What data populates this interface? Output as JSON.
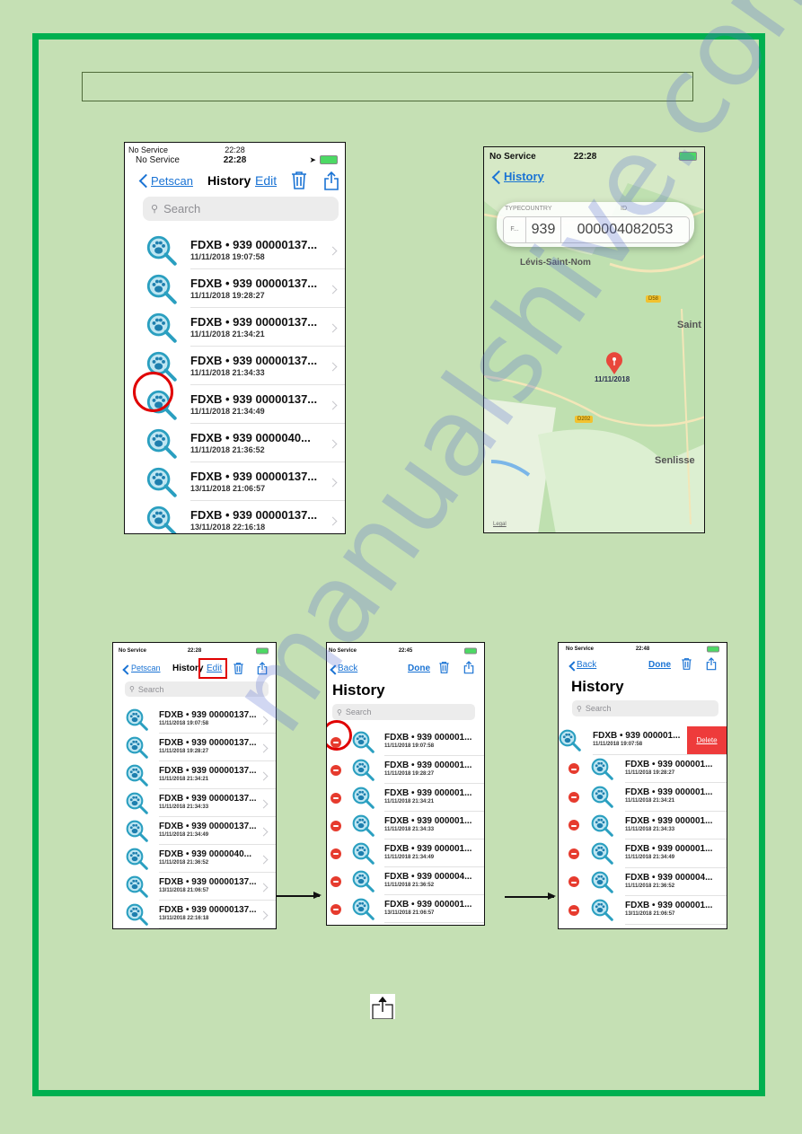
{
  "watermark": "manualshive.com",
  "colors": {
    "frame": "#00b050",
    "background": "#c5e0b4",
    "ios_blue": "#1a73d4",
    "delete_red": "#e63b2e",
    "icon_teal": "#2a9fc0"
  },
  "shot1": {
    "status": {
      "service": "No Service",
      "time": "22:28"
    },
    "nav": {
      "back": "Petscan",
      "title": "History",
      "edit": "Edit"
    },
    "icons": [
      "trash-icon",
      "share-icon"
    ],
    "search_placeholder": "Search",
    "rows": [
      {
        "title": "FDXB • 939 00000137...",
        "date": "11/11/2018 19:07:58"
      },
      {
        "title": "FDXB • 939 00000137...",
        "date": "11/11/2018 19:28:27"
      },
      {
        "title": "FDXB • 939 00000137...",
        "date": "11/11/2018 21:34:21"
      },
      {
        "title": "FDXB • 939 00000137...",
        "date": "11/11/2018 21:34:33"
      },
      {
        "title": "FDXB • 939 00000137...",
        "date": "11/11/2018 21:34:49"
      },
      {
        "title": "FDXB • 939 0000040...",
        "date": "11/11/2018 21:36:52"
      },
      {
        "title": "FDXB • 939 00000137...",
        "date": "13/11/2018 21:06:57"
      },
      {
        "title": "FDXB • 939 00000137...",
        "date": "13/11/2018 22:16:18"
      }
    ]
  },
  "shot2": {
    "status": {
      "service": "No Service",
      "time": "22:28"
    },
    "nav": {
      "back": "History"
    },
    "card": {
      "type_label": "TYPE",
      "country_label": "COUNTRY",
      "id_label": "ID",
      "type_value": "F...",
      "country_value": "939",
      "id_value": "000004082053"
    },
    "map": {
      "places": [
        "Lévis-Saint-Nom",
        "Saint",
        "Senlisse"
      ],
      "roads": [
        "D58",
        "D202"
      ],
      "pin_label": "11/11/2018",
      "legal": "Legal"
    }
  },
  "shot3": {
    "status": {
      "service": "No Service",
      "time": "22:28"
    },
    "nav": {
      "back": "Petscan",
      "title": "History",
      "edit": "Edit"
    },
    "search_placeholder": "Search",
    "rows": [
      {
        "title": "FDXB • 939 00000137...",
        "date": "11/11/2018 19:07:58"
      },
      {
        "title": "FDXB • 939 00000137...",
        "date": "11/11/2018 19:28:27"
      },
      {
        "title": "FDXB • 939 00000137...",
        "date": "11/11/2018 21:34:21"
      },
      {
        "title": "FDXB • 939 00000137...",
        "date": "11/11/2018 21:34:33"
      },
      {
        "title": "FDXB • 939 00000137...",
        "date": "11/11/2018 21:34:49"
      },
      {
        "title": "FDXB • 939 0000040...",
        "date": "11/11/2018 21:36:52"
      },
      {
        "title": "FDXB • 939 00000137...",
        "date": "13/11/2018 21:06:57"
      },
      {
        "title": "FDXB • 939 00000137...",
        "date": "13/11/2018 22:16:18"
      }
    ]
  },
  "shot4": {
    "status": {
      "service": "No Service",
      "time": "22:45"
    },
    "nav": {
      "back": "Back",
      "done": "Done"
    },
    "large_title": "History",
    "search_placeholder": "Search",
    "rows": [
      {
        "title": "FDXB • 939 000001...",
        "date": "11/11/2018 19:07:58"
      },
      {
        "title": "FDXB • 939 000001...",
        "date": "11/11/2018 19:28:27"
      },
      {
        "title": "FDXB • 939 000001...",
        "date": "11/11/2018 21:34:21"
      },
      {
        "title": "FDXB • 939 000001...",
        "date": "11/11/2018 21:34:33"
      },
      {
        "title": "FDXB • 939 000001...",
        "date": "11/11/2018 21:34:49"
      },
      {
        "title": "FDXB • 939 000004...",
        "date": "11/11/2018 21:36:52"
      },
      {
        "title": "FDXB • 939 000001...",
        "date": "13/11/2018 21:06:57"
      }
    ]
  },
  "shot5": {
    "status": {
      "service": "No Service",
      "time": "22:48"
    },
    "nav": {
      "back": "Back",
      "done": "Done"
    },
    "large_title": "History",
    "search_placeholder": "Search",
    "delete_label": "Delete",
    "rows": [
      {
        "title": "FDXB • 939 000001...",
        "date": "11/11/2018 19:07:58"
      },
      {
        "title": "FDXB • 939 000001...",
        "date": "11/11/2018 19:28:27"
      },
      {
        "title": "FDXB • 939 000001...",
        "date": "11/11/2018 21:34:21"
      },
      {
        "title": "FDXB • 939 000001...",
        "date": "11/11/2018 21:34:33"
      },
      {
        "title": "FDXB • 939 000001...",
        "date": "11/11/2018 21:34:49"
      },
      {
        "title": "FDXB • 939 000004...",
        "date": "11/11/2018 21:36:52"
      },
      {
        "title": "FDXB • 939 000001...",
        "date": "13/11/2018 21:06:57"
      }
    ]
  },
  "inline_icon": "share-icon"
}
